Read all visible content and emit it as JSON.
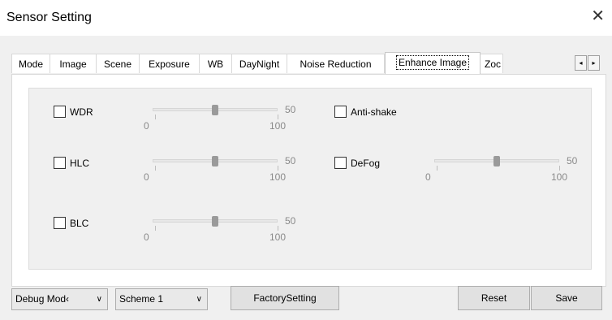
{
  "window": {
    "title": "Sensor Setting",
    "close_glyph": "✕"
  },
  "tabs": [
    "Mode",
    "Image",
    "Scene",
    "Exposure",
    "WB",
    "DayNight",
    "Noise Reduction",
    "Enhance Image",
    "Zoc"
  ],
  "active_tab": "Enhance Image",
  "tab_scroll": {
    "left": "◂",
    "right": "▸"
  },
  "features": {
    "wdr": {
      "label": "WDR",
      "checked": false,
      "value": "50",
      "min": "0",
      "max": "100"
    },
    "hlc": {
      "label": "HLC",
      "checked": false,
      "value": "50",
      "min": "0",
      "max": "100"
    },
    "blc": {
      "label": "BLC",
      "checked": false,
      "value": "50",
      "min": "0",
      "max": "100"
    },
    "anti_shake": {
      "label": "Anti-shake",
      "checked": false
    },
    "defog": {
      "label": "DeFog",
      "checked": false,
      "value": "50",
      "min": "0",
      "max": "100"
    }
  },
  "bottom": {
    "debug_mode": "Debug Mod‹",
    "scheme": "Scheme 1",
    "factory_setting": "FactorySetting",
    "reset": "Reset",
    "save": "Save"
  },
  "icons": {
    "dropdown": "chevron-down-icon",
    "close": "close-icon"
  }
}
